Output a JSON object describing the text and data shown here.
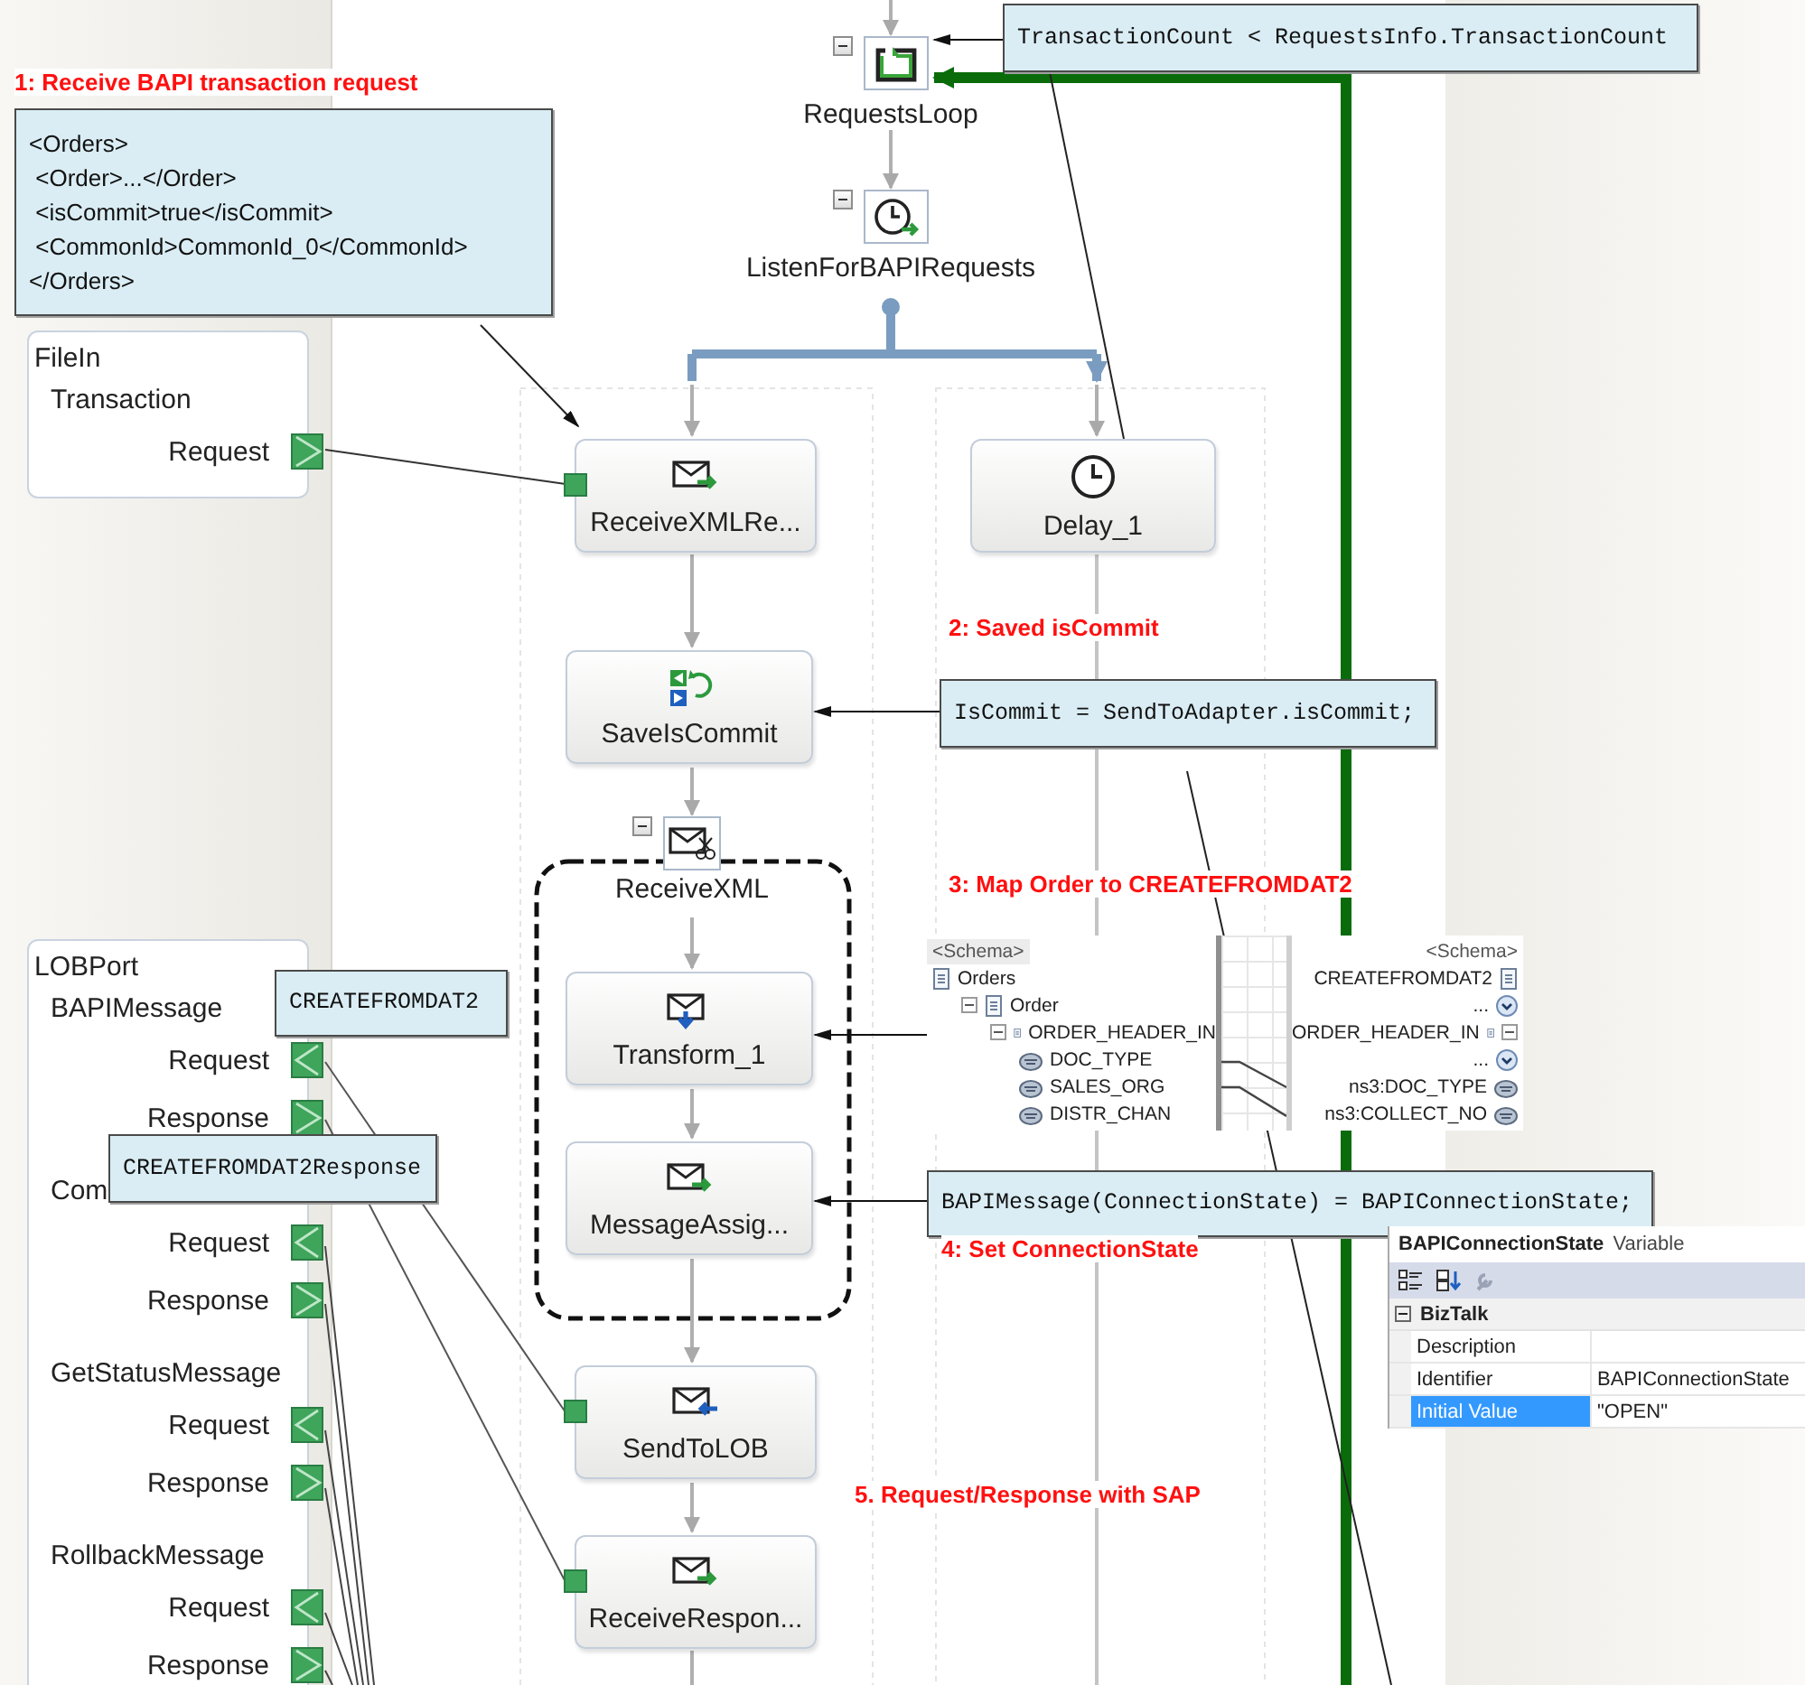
{
  "annotations": [
    {
      "text": "1: Receive BAPI transaction request"
    },
    {
      "text": "2: Saved isCommit"
    },
    {
      "text": "3: Map Order to CREATEFROMDAT2"
    },
    {
      "text": "4: Set ConnectionState"
    },
    {
      "text": "5. Request/Response with SAP"
    }
  ],
  "callouts": [
    {
      "kind": "code",
      "lines": [
        "TransactionCount < RequestsInfo.TransactionCount"
      ]
    },
    {
      "kind": "xml",
      "lines": [
        "<Orders>",
        " <Order>...</Order>",
        " <isCommit>true</isCommit>",
        " <CommonId>CommonId_0</CommonId>",
        "</Orders>"
      ]
    },
    {
      "kind": "code",
      "lines": [
        "IsCommit = SendToAdapter.isCommit;"
      ]
    },
    {
      "kind": "code",
      "lines": [
        "BAPIMessage(ConnectionState) = BAPIConnectionState;"
      ]
    },
    {
      "kind": "code",
      "lines": [
        "CREATEFROMDAT2"
      ]
    },
    {
      "kind": "code",
      "lines": [
        "CREATEFROMDAT2Response"
      ]
    }
  ],
  "containers": [
    {
      "kind": "loop",
      "label": "RequestsLoop",
      "expanded": true
    },
    {
      "kind": "listen",
      "label": "ListenForBAPIRequests",
      "expanded": true
    },
    {
      "kind": "scope",
      "label": "ReceiveXML",
      "expanded": true
    }
  ],
  "shapes": [
    {
      "kind": "receive",
      "label": "ReceiveXMLRe..."
    },
    {
      "kind": "delay",
      "label": "Delay_1"
    },
    {
      "kind": "expression",
      "label": "SaveIsCommit"
    },
    {
      "kind": "transform",
      "label": "Transform_1"
    },
    {
      "kind": "assign",
      "label": "MessageAssig..."
    },
    {
      "kind": "send",
      "label": "SendToLOB"
    },
    {
      "kind": "receive",
      "label": "ReceiveRespon..."
    }
  ],
  "ports": [
    {
      "name": "FileIn",
      "operations": [
        {
          "name": "Transaction",
          "messages": [
            {
              "label": "Request",
              "kind": "receive"
            }
          ]
        }
      ]
    },
    {
      "name": "LOBPort",
      "operations": [
        {
          "name": "BAPIMessage",
          "messages": [
            {
              "label": "Request",
              "kind": "send"
            },
            {
              "label": "Response",
              "kind": "receive"
            }
          ]
        },
        {
          "name": "Com",
          "messages": [
            {
              "label": "Request",
              "kind": "send"
            },
            {
              "label": "Response",
              "kind": "receive"
            }
          ]
        },
        {
          "name": "GetStatusMessage",
          "messages": [
            {
              "label": "Request",
              "kind": "send"
            },
            {
              "label": "Response",
              "kind": "receive"
            }
          ]
        },
        {
          "name": "RollbackMessage",
          "messages": [
            {
              "label": "Request",
              "kind": "send"
            },
            {
              "label": "Response",
              "kind": "receive"
            }
          ]
        }
      ]
    }
  ],
  "map": {
    "source": {
      "header": "<Schema>",
      "nodes": [
        {
          "label": "Orders",
          "children": [
            {
              "label": "Order",
              "children": [
                {
                  "label": "ORDER_HEADER_IN",
                  "children": [
                    {
                      "label": "DOC_TYPE"
                    },
                    {
                      "label": "SALES_ORG"
                    },
                    {
                      "label": "DISTR_CHAN"
                    }
                  ]
                }
              ]
            }
          ]
        }
      ]
    },
    "target": {
      "header": "<Schema>",
      "rows": [
        {
          "kind": "record",
          "label": "CREATEFROMDAT2"
        },
        {
          "kind": "more",
          "label": "..."
        },
        {
          "kind": "group",
          "label": "ORDER_HEADER_IN"
        },
        {
          "kind": "more",
          "label": "..."
        },
        {
          "kind": "field",
          "label": "ns3:DOC_TYPE"
        },
        {
          "kind": "field",
          "label": "ns3:COLLECT_NO"
        }
      ]
    }
  },
  "property_grid": {
    "title": "BAPIConnectionState",
    "subtitle": "Variable",
    "category": {
      "name": "BizTalk",
      "expanded": true
    },
    "rows": [
      {
        "name": "Description",
        "selected": false
      },
      {
        "name": "Identifier",
        "value": "BAPIConnectionState",
        "selected": false
      },
      {
        "name": "Initial Value",
        "value": "\"OPEN\"",
        "selected": true
      }
    ]
  }
}
